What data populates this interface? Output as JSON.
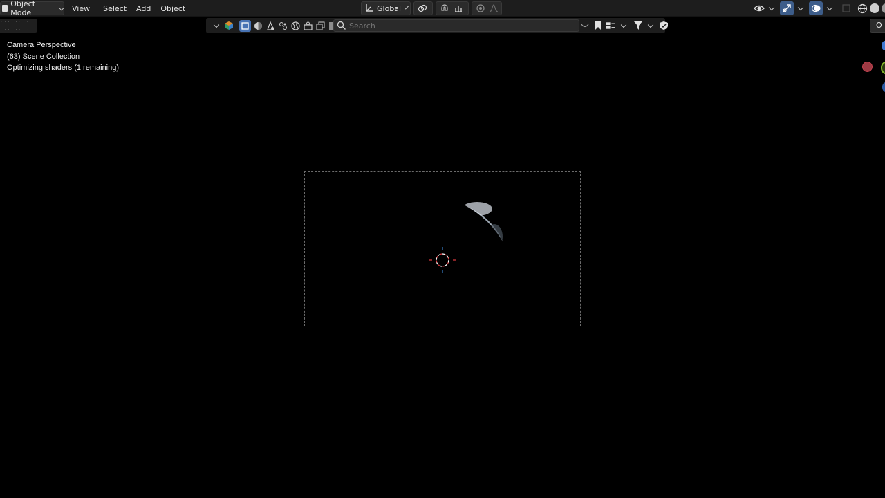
{
  "header": {
    "mode_label": "Object Mode",
    "menu": [
      "View",
      "Select",
      "Add",
      "Object"
    ],
    "transform_orientation": "Global"
  },
  "search": {
    "placeholder": "Search"
  },
  "edge_button_label": "O",
  "overlay": {
    "line1": "Camera Perspective",
    "line2": "(63) Scene Collection",
    "line3": "Optimizing shaders (1 remaining)"
  },
  "colors": {
    "header_bg": "#1d1d1d",
    "viewport_bg": "#000000",
    "accent_blue": "#4772b3",
    "gizmo_x": "#c2434f",
    "gizmo_y": "#84b82a",
    "gizmo_z": "#3f7ad3"
  },
  "icons": [
    "object-mode-cube-icon",
    "transform-orientation-icon",
    "pivot-link-icon",
    "snap-magnet-icon",
    "snap-target-icon",
    "proportional-edit-icon",
    "falloff-curve-icon",
    "visibility-eye-icon",
    "gizmo-toggle-icon",
    "overlay-toggle-icon",
    "xray-icon",
    "wireframe-shading-icon",
    "solid-shading-icon",
    "search-icon",
    "filter-icon",
    "bookmark-icon",
    "shield-icon"
  ]
}
